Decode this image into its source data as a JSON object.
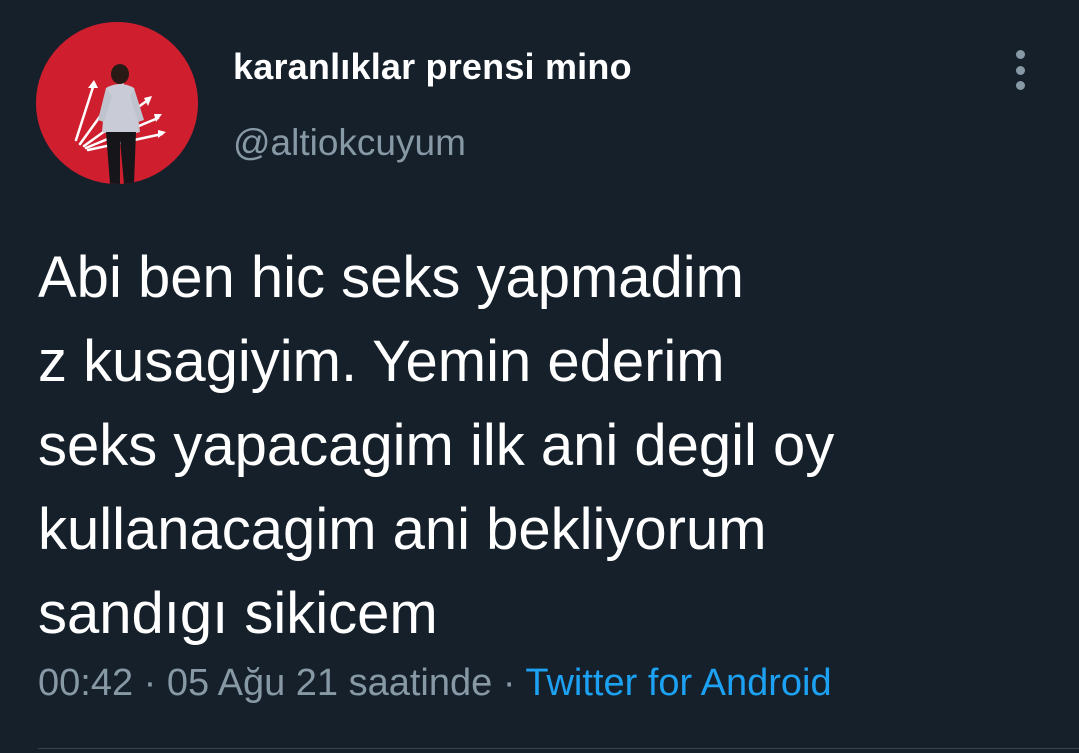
{
  "colors": {
    "background": "#15202b",
    "text_primary": "#ffffff",
    "text_secondary": "#8899a6",
    "link": "#1da1f2",
    "avatar_bg": "#cf1f2e"
  },
  "author": {
    "display_name": "karanlıklar prensi mino",
    "handle": "@altiokcuyum",
    "avatar_icon": "profile-photo"
  },
  "tweet": {
    "text": "Abi ben hic seks yapmadim\nz kusagiyim. Yemin ederim\nseks yapacagim ilk ani degil oy\nkullanacagim ani bekliyorum\nsandıgı sikicem",
    "time": "00:42",
    "date": "05 Ağu 21 saatinde",
    "separator": " · ",
    "source": "Twitter for Android"
  },
  "menu": {
    "icon": "more-vertical-icon"
  }
}
